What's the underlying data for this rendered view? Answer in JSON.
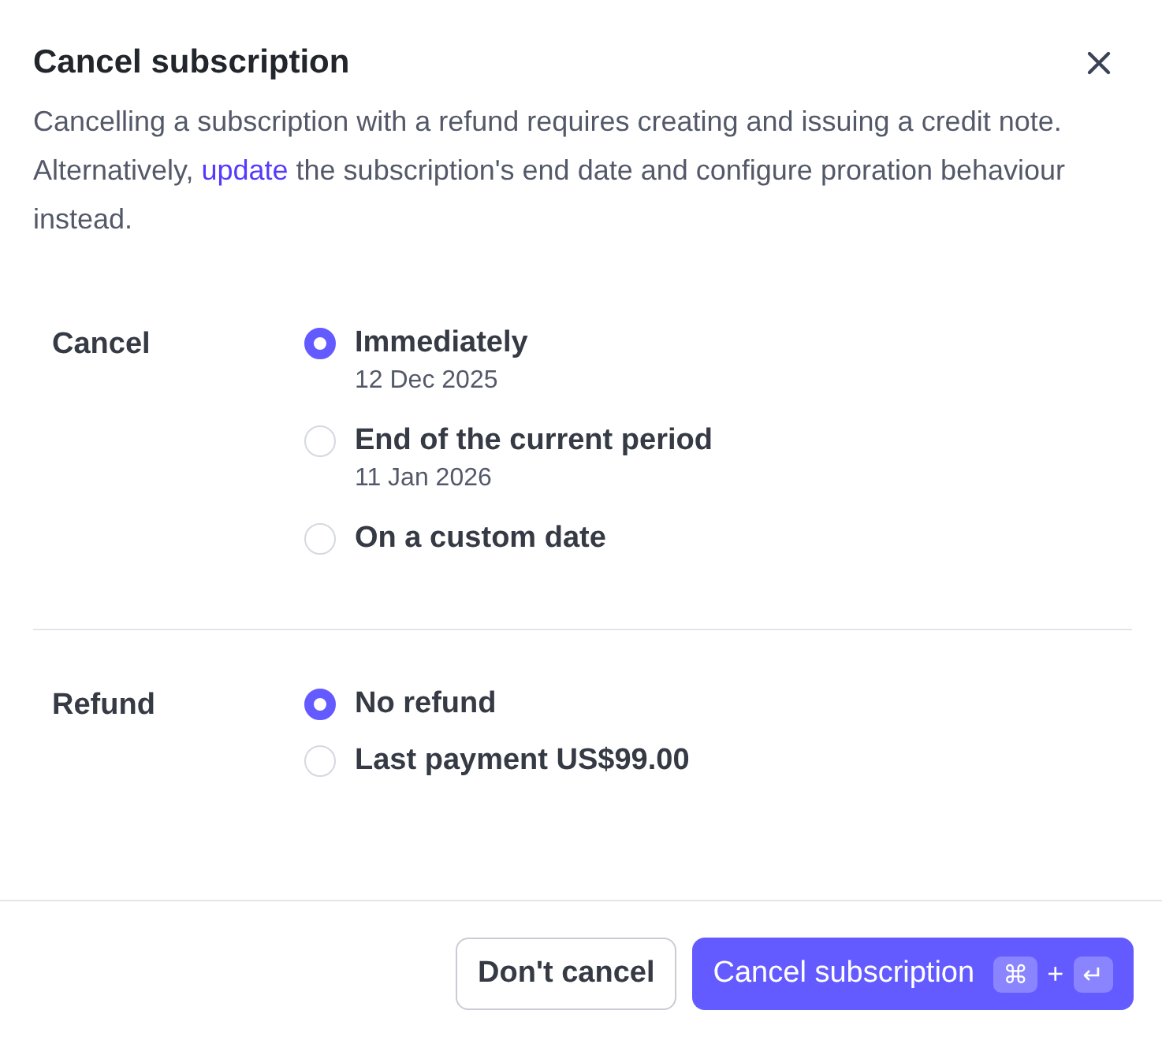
{
  "dialog": {
    "title": "Cancel subscription",
    "description": {
      "before": "Cancelling a subscription with a refund requires creating and issuing a credit note. Alternatively,",
      "link": "update",
      "after": "the subscription's end date and configure proration behaviour instead."
    }
  },
  "sections": [
    {
      "label": "Cancel",
      "options": [
        {
          "label": "Immediately",
          "sublabel": "12 Dec 2025",
          "selected": true
        },
        {
          "label": "End of the current period",
          "sublabel": "11 Jan 2026",
          "selected": false
        },
        {
          "label": "On a custom date",
          "selected": false
        }
      ]
    },
    {
      "label": "Refund",
      "options": [
        {
          "label": "No refund",
          "selected": true
        },
        {
          "label": "Last payment US$99.00",
          "selected": false
        }
      ]
    }
  ],
  "footer": {
    "secondary_button": "Don't cancel",
    "primary_button": {
      "label": "Cancel subscription",
      "shortcut": [
        "⌘",
        "+",
        "↵"
      ]
    }
  }
}
